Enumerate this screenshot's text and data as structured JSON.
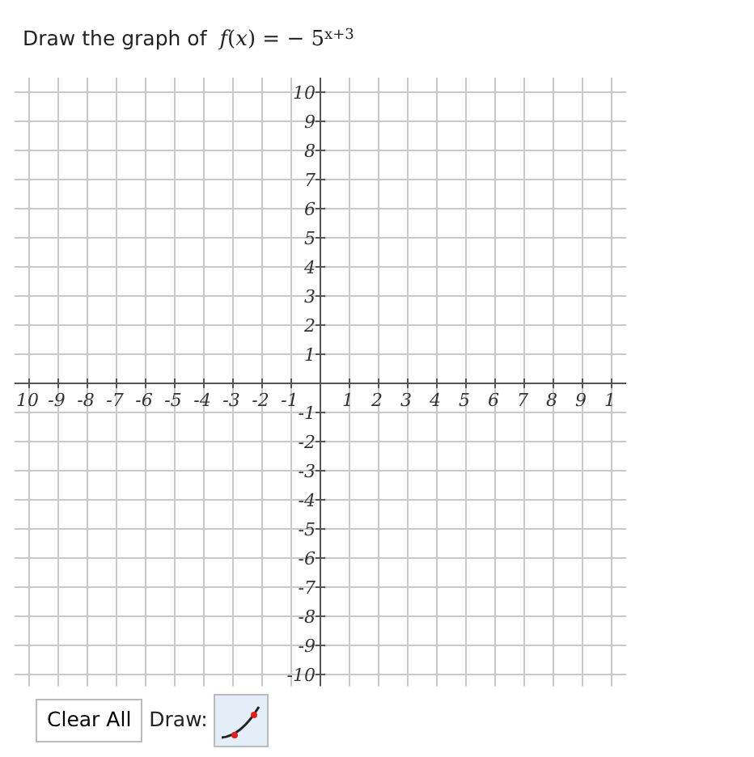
{
  "prompt": "Draw the graph of",
  "formula": "*f*(*x*) =  − 5$^{x+3}$",
  "graph": {
    "x_labels": [
      "10",
      "-9",
      "-8",
      "-7",
      "-6",
      "-5",
      "-4",
      "-3",
      "-2",
      "-1",
      "1",
      "2",
      "3",
      "4",
      "5",
      "6",
      "7",
      "8",
      "9",
      "1"
    ],
    "y_labels": [
      "10",
      "9",
      "8",
      "7",
      "6",
      "5",
      "4",
      "3",
      "2",
      "1",
      "-1",
      "-2",
      "-3",
      "-4",
      "-5",
      "-6",
      "-7",
      "-8",
      "-9",
      "-10"
    ]
  },
  "controls": {
    "clear_button": "Clear All",
    "draw_label": "Draw:",
    "draw_tool": {
      "selected": true
    }
  }
}
